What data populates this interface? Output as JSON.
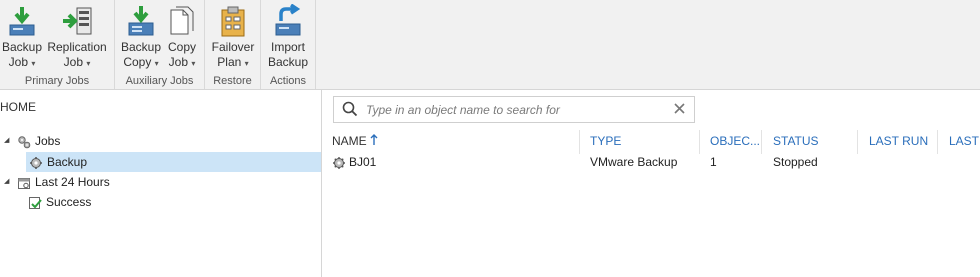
{
  "ribbon": {
    "groups": [
      {
        "label": "Primary Jobs"
      },
      {
        "label": "Auxiliary Jobs"
      },
      {
        "label": "Restore"
      },
      {
        "label": "Actions"
      }
    ],
    "buttons": {
      "backup_job": {
        "line1": "Backup",
        "line2": "Job",
        "icon": "backup-job-icon"
      },
      "replication_job": {
        "line1": "Replication",
        "line2": "Job",
        "icon": "replication-job-icon"
      },
      "backup_copy": {
        "line1": "Backup",
        "line2": "Copy",
        "icon": "backup-copy-icon"
      },
      "copy_job": {
        "line1": "Copy",
        "line2": "Job",
        "icon": "copy-job-icon"
      },
      "failover_plan": {
        "line1": "Failover",
        "line2": "Plan",
        "icon": "failover-plan-icon"
      },
      "import_backup": {
        "line1": "Import",
        "line2": "Backup",
        "icon": "import-backup-icon"
      }
    },
    "caret": "▾"
  },
  "nav": {
    "home_label": "HOME",
    "tree": {
      "jobs": "Jobs",
      "backup": "Backup",
      "last24": "Last 24 Hours",
      "success": "Success"
    }
  },
  "search": {
    "placeholder": "Type in an object name to search for"
  },
  "table": {
    "columns": {
      "name": "NAME",
      "type": "TYPE",
      "objects": "OBJEC...",
      "status": "STATUS",
      "last_run": "LAST RUN",
      "last_result": "LAST I"
    },
    "rows": [
      {
        "name": "BJ01",
        "type": "VMware Backup",
        "objects": "1",
        "status": "Stopped"
      }
    ]
  },
  "colors": {
    "accent": "#2a6ebb",
    "selection": "#cce4f7",
    "ribbon_bg": "#f1f1f1"
  }
}
